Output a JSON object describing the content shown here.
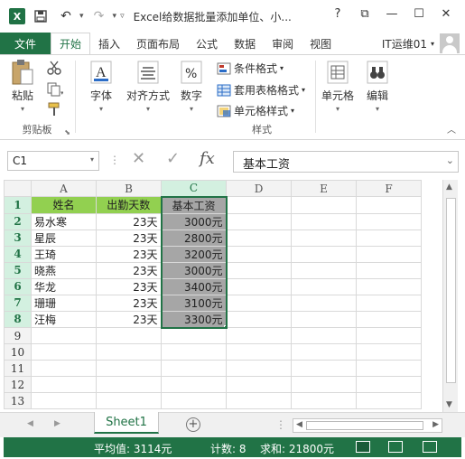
{
  "title_bar": {
    "app_icon": "X",
    "title": "Excel给数据批量添加单位、小...",
    "help": "?",
    "restore": "⧉",
    "minimize": "—",
    "maximize": "☐",
    "close": "✕"
  },
  "tabs": [
    "文件",
    "开始",
    "插入",
    "页面布局",
    "公式",
    "数据",
    "审阅",
    "视图"
  ],
  "active_tab": "开始",
  "account": "IT运维01",
  "ribbon": {
    "clipboard": {
      "paste": "粘贴",
      "group": "剪贴板"
    },
    "font": "字体",
    "alignment": "对齐方式",
    "number": "数字",
    "styles": {
      "conditional": "条件格式",
      "table": "套用表格格式",
      "cell": "单元格样式",
      "group": "样式"
    },
    "cells": "单元格",
    "editing": "编辑"
  },
  "formula_bar": {
    "name_box": "C1",
    "content": "基本工资"
  },
  "columns": [
    "A",
    "B",
    "C",
    "D",
    "E",
    "F"
  ],
  "rows": [
    "1",
    "2",
    "3",
    "4",
    "5",
    "6",
    "7",
    "8",
    "9",
    "10",
    "11",
    "12",
    "13"
  ],
  "sheet": {
    "headers": [
      "姓名",
      "出勤天数",
      "基本工资"
    ],
    "data": [
      [
        "易水寒",
        "23天",
        "3000元"
      ],
      [
        "星辰",
        "23天",
        "2800元"
      ],
      [
        "王琦",
        "23天",
        "3200元"
      ],
      [
        "晓燕",
        "23天",
        "3000元"
      ],
      [
        "华龙",
        "23天",
        "3400元"
      ],
      [
        "珊珊",
        "23天",
        "3100元"
      ],
      [
        "汪梅",
        "23天",
        "3300元"
      ]
    ]
  },
  "sheet_tab": "Sheet1",
  "status_bar": {
    "average": "平均值: 3114元",
    "count": "计数: 8",
    "sum": "求和: 21800元"
  },
  "colors": {
    "excel_green": "#217346",
    "header_green": "#92d050",
    "selection_gray": "#a6a6a6"
  }
}
